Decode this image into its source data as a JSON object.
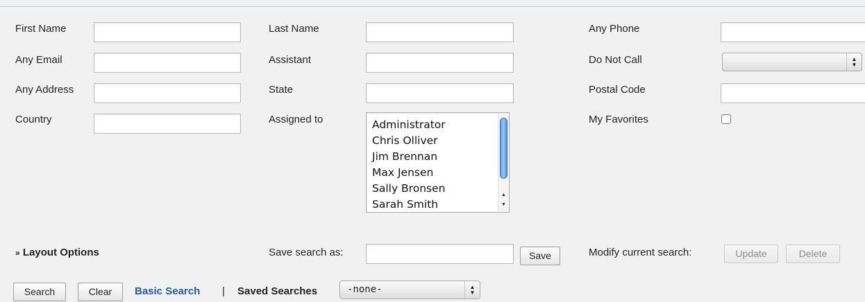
{
  "fields": {
    "first_name": {
      "label": "First Name",
      "value": ""
    },
    "last_name": {
      "label": "Last Name",
      "value": ""
    },
    "any_phone": {
      "label": "Any Phone",
      "value": ""
    },
    "any_email": {
      "label": "Any Email",
      "value": ""
    },
    "assistant": {
      "label": "Assistant",
      "value": ""
    },
    "do_not_call": {
      "label": "Do Not Call",
      "value": ""
    },
    "any_address": {
      "label": "Any Address",
      "value": ""
    },
    "state": {
      "label": "State",
      "value": ""
    },
    "postal_code": {
      "label": "Postal Code",
      "value": ""
    },
    "country": {
      "label": "Country",
      "value": ""
    },
    "assigned_to": {
      "label": "Assigned to",
      "options": [
        "Administrator",
        "Chris Olliver",
        "Jim Brennan",
        "Max Jensen",
        "Sally Bronsen",
        "Sarah Smith"
      ]
    },
    "my_favorites": {
      "label": "My Favorites",
      "checked": false
    }
  },
  "layout_options": {
    "icon": "double-chevron-down-icon",
    "label": "Layout Options"
  },
  "save_search": {
    "label": "Save search as:",
    "value": "",
    "button": "Save"
  },
  "modify_search": {
    "label": "Modify current search:",
    "update": "Update",
    "delete": "Delete"
  },
  "footer": {
    "search": "Search",
    "clear": "Clear",
    "basic_search": "Basic Search",
    "separator": "|",
    "saved_searches_label": "Saved Searches",
    "saved_searches_value": "-none-"
  },
  "colors": {
    "link": "#1b5fa6",
    "scroll_thumb": "#5d9ee6",
    "background": "#f1f1f1"
  }
}
